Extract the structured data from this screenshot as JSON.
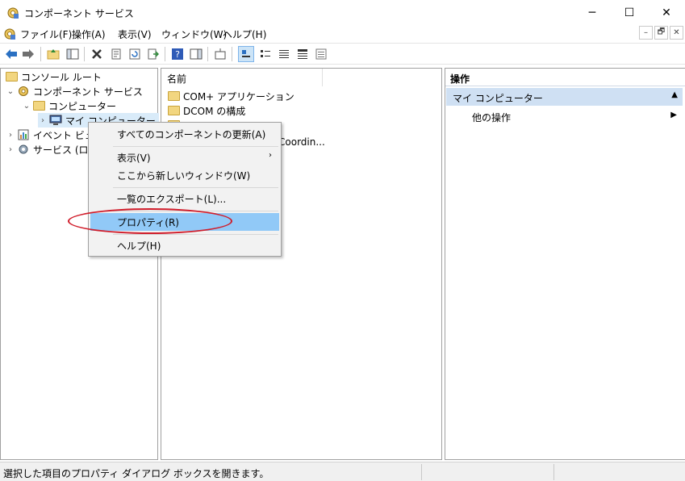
{
  "window": {
    "title": "コンポーネント サービス",
    "minimize_glyph": "─",
    "maximize_glyph": "☐",
    "close_glyph": "✕"
  },
  "menubar": {
    "items": [
      "ファイル(F)",
      "操作(A)",
      "表示(V)",
      "ウィンドウ(W)",
      "ヘルプ(H)"
    ],
    "mdi_minimize": "–",
    "mdi_restore": "🗗",
    "mdi_close": "✕"
  },
  "toolbar": {
    "buttons": [
      "back",
      "forward",
      "up-folder",
      "show-hide-tree",
      "delete",
      "properties",
      "refresh",
      "export-list",
      "help",
      "show-action-pane",
      "new-window",
      "large-icons",
      "small-icons",
      "list-view",
      "detail-view",
      "status-view"
    ]
  },
  "tree": {
    "items": [
      {
        "label": "コンソール ルート",
        "depth": 0
      },
      {
        "label": "コンポーネント サービス",
        "depth": 1
      },
      {
        "label": "コンピューター",
        "depth": 2
      },
      {
        "label": "マイ コンピューター",
        "depth": 3
      },
      {
        "label": "イベント ビュー",
        "depth": 1
      },
      {
        "label": "サービス (ローカ",
        "depth": 1
      }
    ]
  },
  "list": {
    "column_header": "名前",
    "items": [
      "COM+ アプリケーション",
      "DCOM の構成",
      "Coordin..."
    ]
  },
  "context_menu": {
    "items": [
      "すべてのコンポーネントの更新(A)",
      "表示(V)",
      "ここから新しいウィンドウ(W)",
      "一覧のエクスポート(L)...",
      "プロパティ(R)",
      "ヘルプ(H)"
    ],
    "submenu_arrow": "›"
  },
  "actions": {
    "header": "操作",
    "group_label": "マイ コンピューター",
    "group_caret": "▲",
    "item_label": "他の操作",
    "item_arrow": "▶"
  },
  "statusbar": {
    "text": "選択した項目のプロパティ ダイアログ ボックスを開きます。"
  },
  "colors": {
    "highlight": "#91c9f7",
    "annotation_ellipse": "#d01c2a",
    "actions_group_bg": "#cfe0f3"
  }
}
